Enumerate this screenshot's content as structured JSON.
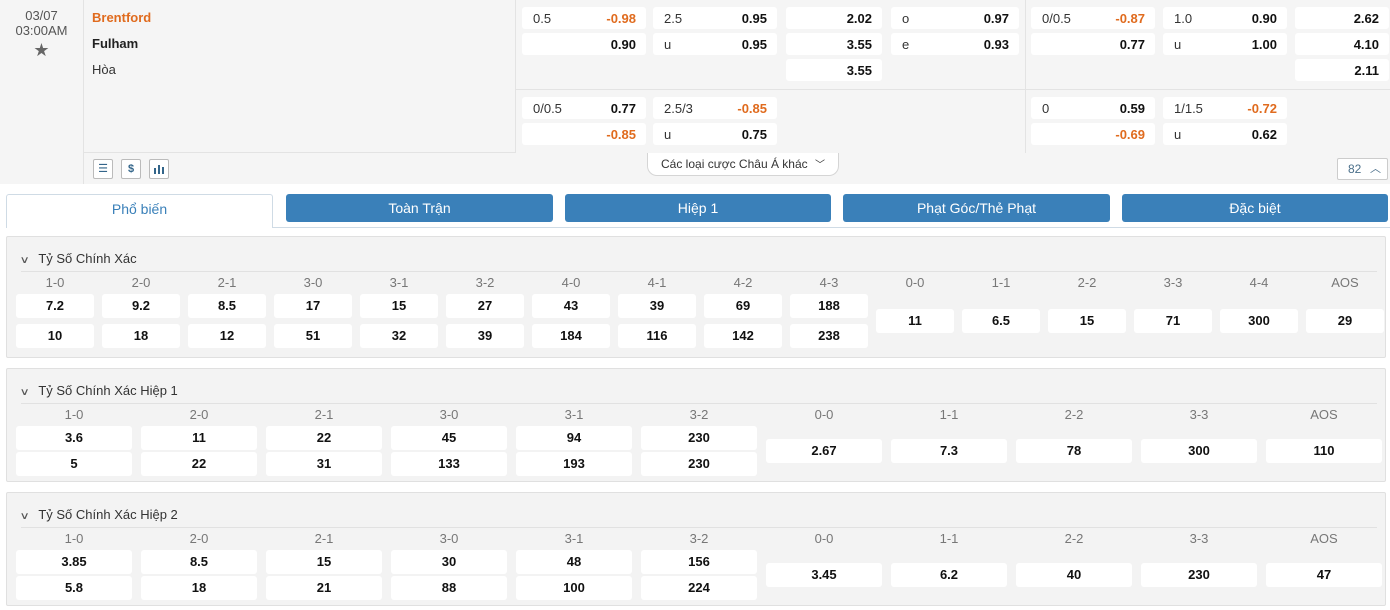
{
  "match": {
    "date": "03/07",
    "time": "03:00AM",
    "home": "Brentford",
    "away": "Fulham",
    "draw": "Hòa"
  },
  "odds": {
    "ah_ft_line": "0.5",
    "ah_ft_home": "-0.98",
    "ah_ft_away": "0.90",
    "ou_ft_line": "2.5",
    "ou_ft_over": "0.95",
    "ou_ft_u": "u",
    "ou_ft_under": "0.95",
    "x12_home": "2.02",
    "x12_away": "3.55",
    "x12_draw": "3.55",
    "oe_o": "o",
    "oe_o_val": "0.97",
    "oe_e": "e",
    "oe_e_val": "0.93",
    "ah_h1_line": "0/0.5",
    "ah_h1_home": "-0.87",
    "ah_h1_away": "0.77",
    "ou_h1_line": "1.0",
    "ou_h1_over": "0.90",
    "ou_h1_u": "u",
    "ou_h1_under": "1.00",
    "x12_h1_home": "2.62",
    "x12_h1_away": "4.10",
    "x12_h1_draw": "2.11",
    "ah_ft2_line": "0/0.5",
    "ah_ft2_home": "0.77",
    "ah_ft2_away": "-0.85",
    "ou_ft2_line": "2.5/3",
    "ou_ft2_over": "-0.85",
    "ou_ft2_u": "u",
    "ou_ft2_under": "0.75",
    "ah_h12_line": "0",
    "ah_h12_home": "0.59",
    "ah_h12_away": "-0.69",
    "ou_h12_line": "1/1.5",
    "ou_h12_over": "-0.72",
    "ou_h12_u": "u",
    "ou_h12_under": "0.62"
  },
  "toolbar": {
    "list_icon": "list-icon",
    "dollar_icon": "dollar-icon",
    "chart_icon": "bar-chart-icon",
    "dollar_glyph": "$",
    "other_markets": "Các loại cược Châu Á khác",
    "count": "82"
  },
  "tabs": [
    "Phổ biến",
    "Toàn Trận",
    "Hiệp 1",
    "Phạt Góc/Thẻ Phạt",
    "Đặc biệt"
  ],
  "sections": [
    {
      "title": "Tỷ Số Chính Xác",
      "pair_headers": [
        "1-0",
        "2-0",
        "2-1",
        "3-0",
        "3-1",
        "3-2",
        "4-0",
        "4-1",
        "4-2",
        "4-3"
      ],
      "pair_home": [
        "7.2",
        "9.2",
        "8.5",
        "17",
        "15",
        "27",
        "43",
        "39",
        "69",
        "188"
      ],
      "pair_away": [
        "10",
        "18",
        "12",
        "51",
        "32",
        "39",
        "184",
        "116",
        "142",
        "238"
      ],
      "single_headers": [
        "0-0",
        "1-1",
        "2-2",
        "3-3",
        "4-4",
        "AOS"
      ],
      "single_values": [
        "11",
        "6.5",
        "15",
        "71",
        "300",
        "29"
      ]
    },
    {
      "title": "Tỷ Số Chính Xác Hiệp 1",
      "pair_headers": [
        "1-0",
        "2-0",
        "2-1",
        "3-0",
        "3-1",
        "3-2"
      ],
      "pair_home": [
        "3.6",
        "11",
        "22",
        "45",
        "94",
        "230"
      ],
      "pair_away": [
        "5",
        "22",
        "31",
        "133",
        "193",
        "230"
      ],
      "single_headers": [
        "0-0",
        "1-1",
        "2-2",
        "3-3",
        "AOS"
      ],
      "single_values": [
        "2.67",
        "7.3",
        "78",
        "300",
        "110"
      ]
    },
    {
      "title": "Tỷ Số Chính Xác Hiệp 2",
      "pair_headers": [
        "1-0",
        "2-0",
        "2-1",
        "3-0",
        "3-1",
        "3-2"
      ],
      "pair_home": [
        "3.85",
        "8.5",
        "15",
        "30",
        "48",
        "156"
      ],
      "pair_away": [
        "5.8",
        "18",
        "21",
        "88",
        "100",
        "224"
      ],
      "single_headers": [
        "0-0",
        "1-1",
        "2-2",
        "3-3",
        "AOS"
      ],
      "single_values": [
        "3.45",
        "6.2",
        "40",
        "230",
        "47"
      ]
    }
  ]
}
